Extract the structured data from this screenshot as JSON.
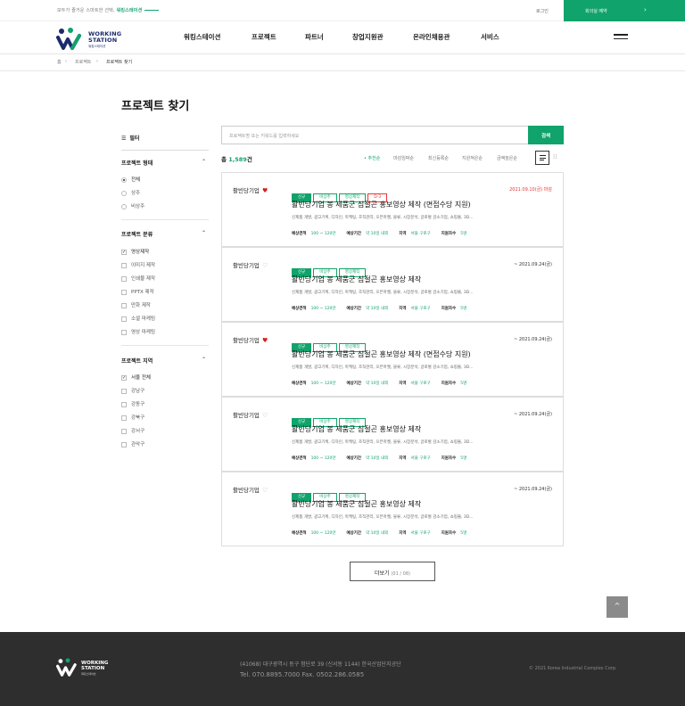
{
  "topbar": {
    "tagline": "모두가 즐거운 스마트한 선택,",
    "tagline_brand": "워킹스테이션",
    "login": "로그인",
    "reserve": "회의실 예약",
    "reserve_arrow": "›"
  },
  "header": {
    "logo_line1": "WORKING",
    "logo_line2": "STATION",
    "logo_sub": "워킹스테이션",
    "nav": [
      "워킹스테이션",
      "프로젝트",
      "파트너",
      "창업지원관",
      "온라인채용관",
      "서비스"
    ]
  },
  "breadcrumb": [
    "홈",
    "프로젝트",
    "프로젝트 찾기"
  ],
  "page_title": "프로젝트 찾기",
  "sidebar": {
    "filter_label": "필터",
    "sections": [
      {
        "title": "프로젝트 형태",
        "type": "radio",
        "options": [
          {
            "label": "전체",
            "checked": true
          },
          {
            "label": "상주",
            "checked": false
          },
          {
            "label": "비상주",
            "checked": false
          }
        ]
      },
      {
        "title": "프로젝트 분류",
        "type": "checkbox",
        "options": [
          {
            "label": "영상제작",
            "checked": true
          },
          {
            "label": "이미지 제작",
            "checked": false
          },
          {
            "label": "인쇄물 제작",
            "checked": false
          },
          {
            "label": "PPTX 제작",
            "checked": false
          },
          {
            "label": "만화 제작",
            "checked": false
          },
          {
            "label": "소셜 마케팅",
            "checked": false
          },
          {
            "label": "영상 마케팅",
            "checked": false
          }
        ]
      },
      {
        "title": "프로젝트 지역",
        "type": "checkbox",
        "options": [
          {
            "label": "서울 전체",
            "checked": true
          },
          {
            "label": "강남구",
            "checked": false
          },
          {
            "label": "강동구",
            "checked": false
          },
          {
            "label": "강북구",
            "checked": false
          },
          {
            "label": "강서구",
            "checked": false
          },
          {
            "label": "관악구",
            "checked": false
          }
        ]
      }
    ]
  },
  "search": {
    "placeholder": "프로젝트명 또는 키워드를 입력하세요",
    "button": "검색"
  },
  "results": {
    "total_prefix": "총",
    "total_count": "1,589",
    "total_suffix": "건",
    "sort_options": [
      "추천순",
      "마감임박순",
      "최신등록순",
      "지원적은순",
      "금액높은순"
    ],
    "sort_active": "추천순"
  },
  "meta_labels": {
    "budget": "예상견적",
    "period": "예상기간",
    "region": "지역",
    "applicants": "지원자수"
  },
  "projects": [
    {
      "company": "활빈당기업",
      "favorited": true,
      "tags": [
        "신규",
        "비상주",
        "영상제작",
        "D-3"
      ],
      "date": "2021.09.10(금) 마감",
      "date_highlight": true,
      "title": "활빈당기업 봉 제품군 심절곤 홍보영상 제작 (면접수당 지원)",
      "desc": "신제품 개발, 광고기획, 디자인, 마케팅, 조직관리, 오픈마켓, 물류, 시장분석, 글로벌 감소기업, 쇼핑몰, 3D...",
      "budget": "100 ~ 120만",
      "period": "약 10일 내외",
      "region": "서울 구로구",
      "applicants": "5명"
    },
    {
      "company": "활빈당기업",
      "favorited": false,
      "tags": [
        "신규",
        "비상주",
        "영상제작"
      ],
      "date": "~ 2021.09.24(금)",
      "date_highlight": false,
      "title": "활빈당기업 봉 제품군 심절곤 홍보영상 제작",
      "desc": "신제품 개발, 광고기획, 디자인, 마케팅, 조직관리, 오픈마켓, 물류, 시장분석, 글로벌 감소기업, 쇼핑몰, 3D...",
      "budget": "100 ~ 120만",
      "period": "약 10일 내외",
      "region": "서울 구로구",
      "applicants": "5명"
    },
    {
      "company": "활빈당기업",
      "favorited": true,
      "tags": [
        "신규",
        "비상주",
        "영상제작"
      ],
      "date": "~ 2021.09.24(금)",
      "date_highlight": false,
      "title": "활빈당기업 봉 제품군 심절곤 홍보영상 제작 (면접수당 지원)",
      "desc": "신제품 개발, 광고기획, 디자인, 마케팅, 조직관리, 오픈마켓, 물류, 시장분석, 글로벌 감소기업, 쇼핑몰, 3D...",
      "budget": "100 ~ 120만",
      "period": "약 10일 내외",
      "region": "서울 구로구",
      "applicants": "5명"
    },
    {
      "company": "활빈당기업",
      "favorited": false,
      "tags": [
        "신규",
        "비상주",
        "영상제작"
      ],
      "date": "~ 2021.09.24(금)",
      "date_highlight": false,
      "title": "활빈당기업 봉 제품군 심절곤 홍보영상 제작",
      "desc": "신제품 개발, 광고기획, 디자인, 마케팅, 조직관리, 오픈마켓, 물류, 시장분석, 글로벌 감소기업, 쇼핑몰, 3D...",
      "budget": "100 ~ 120만",
      "period": "약 10일 내외",
      "region": "서울 구로구",
      "applicants": "5명"
    },
    {
      "company": "활빈당기업",
      "favorited": false,
      "tags": [
        "신규",
        "비상주",
        "영상제작"
      ],
      "date": "~ 2021.09.24(금)",
      "date_highlight": false,
      "title": "활빈당기업 봉 제품군 심절곤 홍보영상 제작",
      "desc": "신제품 개발, 광고기획, 디자인, 마케팅, 조직관리, 오픈마켓, 물류, 시장분석, 글로벌 감소기업, 쇼핑몰, 3D...",
      "budget": "100 ~ 120만",
      "period": "약 10일 내외",
      "region": "서울 구로구",
      "applicants": "5명"
    }
  ],
  "more": {
    "label": "더보기",
    "page": "(01 / 08)"
  },
  "totop_icon": "^",
  "footer": {
    "logo_line1": "WORKING",
    "logo_line2": "STATION",
    "logo_sub": "워킹스테이션",
    "address": "(41068) 대구광역시 동구 첨단로 39 (신서동 1144) 한국산업단지공단",
    "tel": "Tel. 070.8895.7000    Fax. 0502.286.0585",
    "copyright": "© 2021 Korea Industrial Complex Corp."
  },
  "colors": {
    "brand": "#10a36b",
    "alert": "#e33333",
    "footer_bg": "#2e2e2e"
  }
}
